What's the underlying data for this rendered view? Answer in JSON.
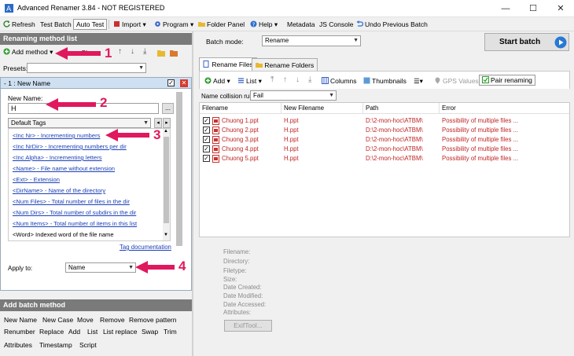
{
  "window": {
    "title": "Advanced Renamer 3.84 - NOT REGISTERED",
    "minimize": "—",
    "maximize": "☐",
    "close": "✕"
  },
  "toolbar": {
    "refresh": "Refresh",
    "test_batch": "Test Batch",
    "auto_test": "Auto Test",
    "import": "Import",
    "program": "Program",
    "folder_panel": "Folder Panel",
    "help": "Help",
    "metadata": "Metadata",
    "js_console": "JS Console",
    "undo": "Undo Previous Batch"
  },
  "left": {
    "header": "Renaming method list",
    "add_method": "Add method",
    "clear": "Clear",
    "presets_label": "Presets:",
    "method_title": "1 : New Name",
    "new_name_label": "New Name:",
    "new_name_value": "H",
    "browse": "...",
    "tags_combo": "Default Tags",
    "tags": [
      {
        "tag": "<Inc Nr>",
        "desc": " - Incrementing numbers"
      },
      {
        "tag": "<Inc NrDir>",
        "desc": " - Incrementing numbers per dir"
      },
      {
        "tag": "<Inc Alpha>",
        "desc": " - Incrementing letters"
      },
      {
        "tag": "<Name>",
        "desc": " - File name without extension"
      },
      {
        "tag": "<Ext>",
        "desc": " - Extension"
      },
      {
        "tag": "<DirName>",
        "desc": " - Name of the directory"
      },
      {
        "tag": "<Num Files>",
        "desc": " - Total number of files in the dir"
      },
      {
        "tag": "<Num Dirs>",
        "desc": " - Total number of subdirs in the dir"
      },
      {
        "tag": "<Num Items>",
        "desc": " - Total number of items in this list"
      },
      {
        "tag": "<Word>",
        "desc": " Indexed word of the file name"
      }
    ],
    "tag_doc": "Tag documentation",
    "apply_to_label": "Apply to:",
    "apply_to_value": "Name",
    "batch_header": "Add batch method",
    "batch_methods": [
      [
        "New Name",
        "New Case",
        "Move",
        "Remove",
        "Remove pattern"
      ],
      [
        "Renumber",
        "Replace",
        "Add",
        "List",
        "List replace",
        "Swap",
        "Trim"
      ],
      [
        "Attributes",
        "Timestamp",
        "Script"
      ]
    ]
  },
  "right": {
    "batch_mode_label": "Batch mode:",
    "batch_mode_value": "Rename",
    "start_batch": "Start batch",
    "tabs": [
      "Rename Files",
      "Rename Folders"
    ],
    "list_toolbar": {
      "add": "Add",
      "list": "List",
      "columns": "Columns",
      "thumbnails": "Thumbnails",
      "gps": "GPS Values",
      "pair": "Pair renaming"
    },
    "collision_label": "Name collision rule:",
    "collision_value": "Fail",
    "columns": [
      "Filename",
      "New Filename",
      "Path",
      "Error"
    ],
    "rows": [
      {
        "filename": "Chuong 1.ppt",
        "new": "H.ppt",
        "path": "D:\\2-mon-hoc\\ATBM\\",
        "error": "Possibility of multiple files ..."
      },
      {
        "filename": "Chuong 2.ppt",
        "new": "H.ppt",
        "path": "D:\\2-mon-hoc\\ATBM\\",
        "error": "Possibility of multiple files ..."
      },
      {
        "filename": "Chuong 3.ppt",
        "new": "H.ppt",
        "path": "D:\\2-mon-hoc\\ATBM\\",
        "error": "Possibility of multiple files ..."
      },
      {
        "filename": "Chuong 4.ppt",
        "new": "H.ppt",
        "path": "D:\\2-mon-hoc\\ATBM\\",
        "error": "Possibility of multiple files ..."
      },
      {
        "filename": "Chuong 5.ppt",
        "new": "H.ppt",
        "path": "D:\\2-mon-hoc\\ATBM\\",
        "error": "Possibility of multiple files ..."
      }
    ],
    "properties": [
      "Filename:",
      "Directory:",
      "Filetype:",
      "Size:",
      "Date Created:",
      "Date Modified:",
      "Date Accessed:",
      "Attributes:"
    ],
    "exiftool": "ExifTool..."
  },
  "annotations": [
    "1",
    "2",
    "3",
    "4"
  ],
  "colors": {
    "annotation": "#e0185e",
    "error_text": "#c02525",
    "header_bg": "#7a7a7a",
    "link": "#1d41b8"
  }
}
